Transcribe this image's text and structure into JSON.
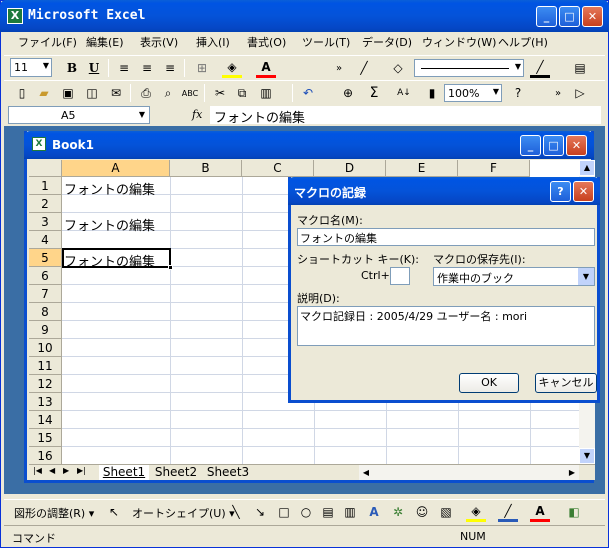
{
  "app": {
    "title": "Microsoft Excel"
  },
  "menubar": [
    "ファイル(F)",
    "編集(E)",
    "表示(V)",
    "挿入(I)",
    "書式(O)",
    "ツール(T)",
    "データ(D)",
    "ウィンドウ(W)",
    "ヘルプ(H)"
  ],
  "format_toolbar": {
    "font_size": "11"
  },
  "std_toolbar": {
    "zoom": "100%"
  },
  "formula_bar": {
    "name_box": "A5",
    "fx": "fx",
    "content": "フォントの編集"
  },
  "workbook": {
    "title": "Book1",
    "columns": [
      "A",
      "B",
      "C",
      "D",
      "E",
      "F"
    ],
    "rows": [
      "1",
      "2",
      "3",
      "4",
      "5",
      "6",
      "7",
      "8",
      "9",
      "10",
      "11",
      "12",
      "13",
      "14",
      "15",
      "16"
    ],
    "cells": {
      "A1": "フォントの編集",
      "A3": "フォントの編集",
      "A5": "フォントの編集"
    },
    "sheets": [
      "Sheet1",
      "Sheet2",
      "Sheet3"
    ],
    "active_sheet": "Sheet1"
  },
  "dialog": {
    "title": "マクロの記録",
    "macro_name_label": "マクロ名(M):",
    "macro_name_value": "フォントの編集",
    "shortcut_label": "ショートカット キー(K):",
    "ctrl_label": "Ctrl+",
    "shortcut_value": "",
    "store_label": "マクロの保存先(I):",
    "store_value": "作業中のブック",
    "desc_label": "説明(D):",
    "desc_value": "マクロ記録日 : 2005/4/29  ユーザー名 : mori",
    "ok_label": "OK",
    "cancel_label": "キャンセル"
  },
  "drawing_toolbar": {
    "draw_label": "図形の調整(R) ▾",
    "autoshape_label": "オートシェイプ(U) ▾"
  },
  "statusbar": {
    "left": "コマンド",
    "right": "NUM"
  },
  "colors": {
    "xp_blue": "#0054E3",
    "face": "#ECE9D8",
    "grid": "#D0D7E5"
  }
}
